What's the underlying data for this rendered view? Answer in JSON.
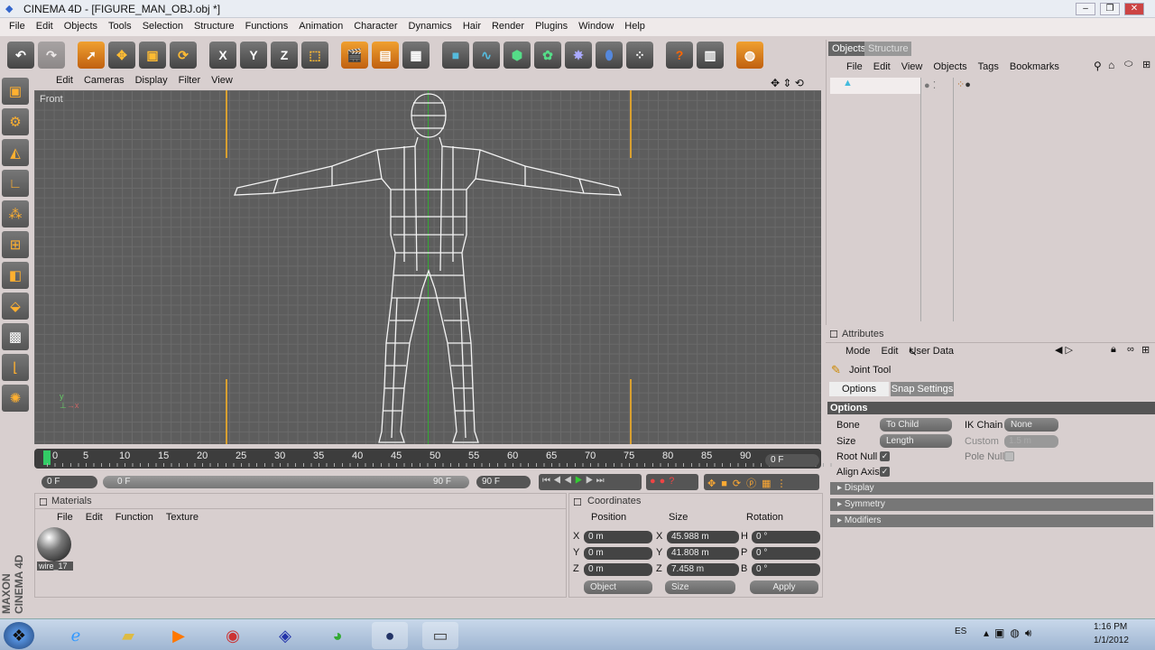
{
  "window": {
    "title": "CINEMA 4D - [FIGURE_MAN_OBJ.obj *]"
  },
  "menu": [
    "File",
    "Edit",
    "Objects",
    "Tools",
    "Selection",
    "Structure",
    "Functions",
    "Animation",
    "Character",
    "Dynamics",
    "Hair",
    "Render",
    "Plugins",
    "Window",
    "Help"
  ],
  "toolbar": {
    "axis": [
      "X",
      "Y",
      "Z"
    ]
  },
  "viewport": {
    "menu": [
      "Edit",
      "Cameras",
      "Display",
      "Filter",
      "View"
    ],
    "label": "Front"
  },
  "timeline": {
    "ticks": [
      "0",
      "5",
      "10",
      "15",
      "20",
      "25",
      "30",
      "35",
      "40",
      "45",
      "50",
      "55",
      "60",
      "65",
      "70",
      "75",
      "80",
      "85",
      "90"
    ],
    "current": "0 F",
    "start": "0 F",
    "range_start": "0 F",
    "range_end": "90 F",
    "end": "90 F"
  },
  "materials": {
    "title": "Materials",
    "menu": [
      "File",
      "Edit",
      "Function",
      "Texture"
    ],
    "item": "wire_17"
  },
  "coordinates": {
    "title": "Coordinates",
    "headers": [
      "Position",
      "Size",
      "Rotation"
    ],
    "rows": [
      {
        "pl": "X",
        "p": "0 m",
        "sl": "X",
        "s": "45.988 m",
        "rl": "H",
        "r": "0 °"
      },
      {
        "pl": "Y",
        "p": "0 m",
        "sl": "Y",
        "s": "41.808 m",
        "rl": "P",
        "r": "0 °"
      },
      {
        "pl": "Z",
        "p": "0 m",
        "sl": "Z",
        "s": "7.458 m",
        "rl": "B",
        "r": "0 °"
      }
    ],
    "mode": "Object",
    "size_mode": "Size",
    "apply": "Apply"
  },
  "objects": {
    "tabs": [
      "Objects",
      "Structure"
    ],
    "menu": [
      "File",
      "Edit",
      "View",
      "Objects",
      "Tags",
      "Bookmarks"
    ]
  },
  "attributes": {
    "title": "Attributes",
    "menu": [
      "Mode",
      "Edit",
      "User Data"
    ],
    "tool": "Joint Tool",
    "tabs": [
      "Options",
      "Snap Settings"
    ],
    "section": "Options",
    "bone_label": "Bone",
    "bone": "To Child",
    "ik_label": "IK Chain",
    "ik": "None",
    "size_label": "Size",
    "size": "Length",
    "custom_label": "Custom",
    "custom": "1.5 m",
    "root_null": "Root Null",
    "pole_null": "Pole Null",
    "align_axis": "Align Axis",
    "groups": [
      "Display",
      "Symmetry",
      "Modifiers"
    ]
  },
  "brand": "MAXON CINEMA 4D",
  "taskbar": {
    "lang": "ES",
    "time": "1:16 PM",
    "date": "1/1/2012"
  }
}
